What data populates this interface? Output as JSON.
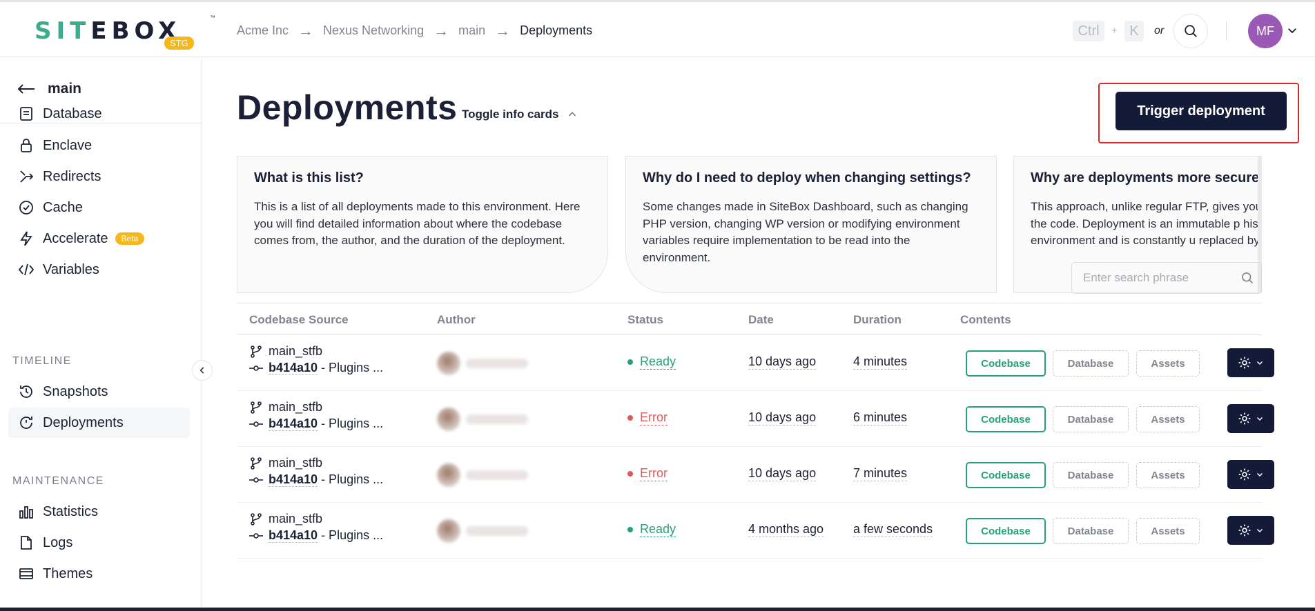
{
  "header": {
    "logo": {
      "part1": "SIT",
      "part2": "E",
      "part3": "BOX",
      "badge": "STG",
      "tm": "™"
    },
    "breadcrumb": [
      "Acme Inc",
      "Nexus Networking",
      "main",
      "Deployments"
    ],
    "breadcrumb_sep": "→",
    "shortcut": {
      "key1": "Ctrl",
      "plus": "+",
      "key2": "K",
      "or": "or"
    },
    "avatar_initials": "MF"
  },
  "sidebar": {
    "back_label": "main",
    "items_top": [
      {
        "label": "Database",
        "icon": "file-icon"
      },
      {
        "label": "Enclave",
        "icon": "lock-icon"
      },
      {
        "label": "Redirects",
        "icon": "redirect-icon"
      },
      {
        "label": "Cache",
        "icon": "cache-icon"
      },
      {
        "label": "Accelerate",
        "icon": "bolt-icon",
        "badge": "Beta"
      },
      {
        "label": "Variables",
        "icon": "code-icon"
      }
    ],
    "section_timeline": "TIMELINE",
    "timeline_items": [
      {
        "label": "Snapshots",
        "icon": "history-icon"
      },
      {
        "label": "Deployments",
        "icon": "deploy-icon"
      }
    ],
    "section_maintenance": "MAINTENANCE",
    "maintenance_items": [
      {
        "label": "Statistics",
        "icon": "chart-icon"
      },
      {
        "label": "Logs",
        "icon": "file-icon"
      },
      {
        "label": "Themes",
        "icon": "layers-icon"
      }
    ]
  },
  "main": {
    "title": "Deployments",
    "toggle_label": "Toggle info cards",
    "trigger_label": "Trigger deployment",
    "cards": [
      {
        "title": "What is this list?",
        "body": "This is a list of all deployments made to this environment. Here you will find detailed information about where the codebase comes from, the author, and the duration of the deployment."
      },
      {
        "title": "Why do I need to deploy when changing settings?",
        "body": "Some changes made in SiteBox Dashboard, such as changing PHP version, changing WP version or modifying environment variables require implementation to be read into the environment."
      },
      {
        "title": "Why are deployments more secure?",
        "body": "This approach, unlike regular FTP, gives you a l over the code. Deployment is an immutable p history of the environment and is constantly u replaced by a new one."
      }
    ],
    "search_placeholder": "Enter search phrase",
    "columns": [
      "Codebase Source",
      "Author",
      "Status",
      "Date",
      "Duration",
      "Contents"
    ],
    "rows": [
      {
        "branch": "main_stfb",
        "commit": "b414a10",
        "msg": " - Plugins ...",
        "status": "Ready",
        "date": "10 days ago",
        "duration": "4 minutes",
        "c1": "Codebase",
        "c2": "Database",
        "c3": "Assets"
      },
      {
        "branch": "main_stfb",
        "commit": "b414a10",
        "msg": " - Plugins ...",
        "status": "Error",
        "date": "10 days ago",
        "duration": "6 minutes",
        "c1": "Codebase",
        "c2": "Database",
        "c3": "Assets"
      },
      {
        "branch": "main_stfb",
        "commit": "b414a10",
        "msg": " - Plugins ...",
        "status": "Error",
        "date": "10 days ago",
        "duration": "7 minutes",
        "c1": "Codebase",
        "c2": "Database",
        "c3": "Assets"
      },
      {
        "branch": "main_stfb",
        "commit": "b414a10",
        "msg": " - Plugins ...",
        "status": "Ready",
        "date": "4 months ago",
        "duration": "a few seconds",
        "c1": "Codebase",
        "c2": "Database",
        "c3": "Assets"
      }
    ]
  },
  "colors": {
    "ready": "#27a17d",
    "error": "#e05a5a",
    "accent": "#3aae8c",
    "navy": "#141b38",
    "badge": "#f5b81c"
  }
}
